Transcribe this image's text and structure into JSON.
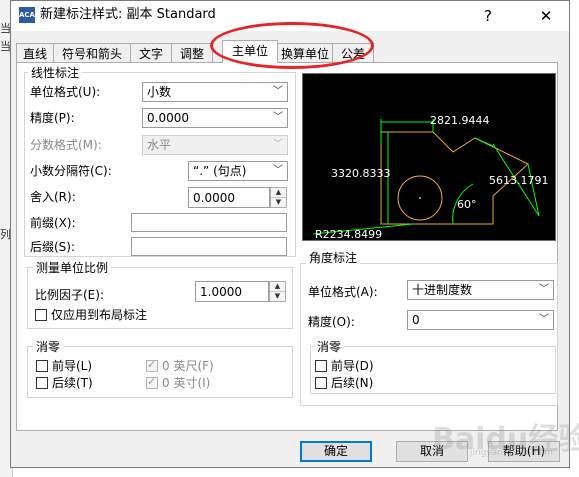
{
  "window": {
    "title": "新建标注样式: 副本 Standard",
    "app_icon_text": "ACAD",
    "help_label": "?",
    "close_label": "✕"
  },
  "background_fragments": [
    "当",
    "当",
    "列"
  ],
  "tabs": [
    {
      "label": "直线",
      "active": false
    },
    {
      "label": "符号和箭头",
      "active": false
    },
    {
      "label": "文字",
      "active": false
    },
    {
      "label": "调整",
      "active": false
    },
    {
      "label": "主单位",
      "active": true
    },
    {
      "label": "换算单位",
      "active": false
    },
    {
      "label": "公差",
      "active": false
    }
  ],
  "linear": {
    "title": "线性标注",
    "unit_format_label": "单位格式(U):",
    "unit_format_value": "小数",
    "precision_label": "精度(P):",
    "precision_value": "0.0000",
    "fraction_format_label": "分数格式(M):",
    "fraction_format_value": "水平",
    "decimal_separator_label": "小数分隔符(C):",
    "decimal_separator_value": "“.” (句点)",
    "round_off_label": "舍入(R):",
    "round_off_value": "0.0000",
    "prefix_label": "前缀(X):",
    "prefix_value": "",
    "suffix_label": "后缀(S):",
    "suffix_value": ""
  },
  "scale": {
    "title": "测量单位比例",
    "factor_label": "比例因子(E):",
    "factor_value": "1.0000",
    "layout_only_label": "仅应用到布局标注"
  },
  "zero_suppression_linear": {
    "title": "消零",
    "leading_label": "前导(L)",
    "trailing_label": "后续(T)",
    "feet_label": "0 英尺(F)",
    "inches_label": "0 英寸(I)"
  },
  "angular": {
    "title": "角度标注",
    "unit_format_label": "单位格式(A):",
    "unit_format_value": "十进制度数",
    "precision_label": "精度(O):",
    "precision_value": "0"
  },
  "zero_suppression_angular": {
    "title": "消零",
    "leading_label": "前导(D)",
    "trailing_label": "后续(N)"
  },
  "preview": {
    "dim_top": "2821.9444",
    "dim_left": "3320.8333",
    "dim_right": "5613.1791",
    "angle": "60°",
    "radius": "R2234.8499"
  },
  "buttons": {
    "ok": "确定",
    "cancel": "取消",
    "help": "帮助(H)"
  },
  "watermark": {
    "main": "Baidu经验",
    "sub": "jingyan.baidu.com"
  },
  "colors": {
    "annotation_circle": "#e4262b",
    "preview_bg": "#000000",
    "dim_lines": "#00ff00",
    "geometry": "#f0a33c"
  }
}
